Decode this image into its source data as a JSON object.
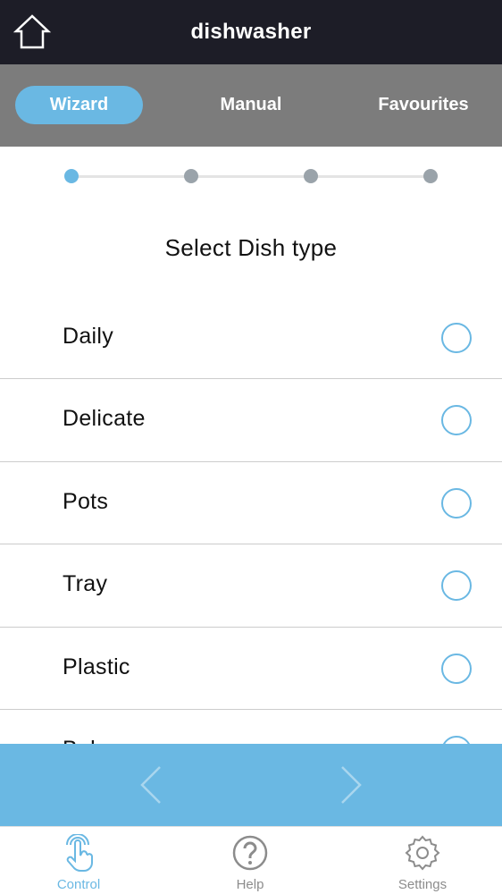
{
  "header": {
    "title": "dishwasher",
    "home_icon": "home-icon"
  },
  "tabs": [
    {
      "label": "Wizard",
      "active": true
    },
    {
      "label": "Manual",
      "active": false
    },
    {
      "label": "Favourites",
      "active": false
    }
  ],
  "stepper": {
    "total_steps": 4,
    "current_step": 1
  },
  "main": {
    "title": "Select Dish type",
    "items": [
      {
        "label": "Daily",
        "selected": false
      },
      {
        "label": "Delicate",
        "selected": false
      },
      {
        "label": "Pots",
        "selected": false
      },
      {
        "label": "Tray",
        "selected": false
      },
      {
        "label": "Plastic",
        "selected": false
      },
      {
        "label": "Baby",
        "selected": false
      }
    ]
  },
  "navigation": {
    "prev_icon": "chevron-left-icon",
    "next_icon": "chevron-right-icon"
  },
  "bottom_bar": {
    "items": [
      {
        "label": "Control",
        "icon": "hand-tap-icon",
        "active": true
      },
      {
        "label": "Help",
        "icon": "help-icon",
        "active": false
      },
      {
        "label": "Settings",
        "icon": "gear-icon",
        "active": false
      }
    ]
  },
  "colors": {
    "accent": "#6ab8e3",
    "header_bg": "#1d1d27",
    "tabs_bg": "#7c7c7c"
  }
}
